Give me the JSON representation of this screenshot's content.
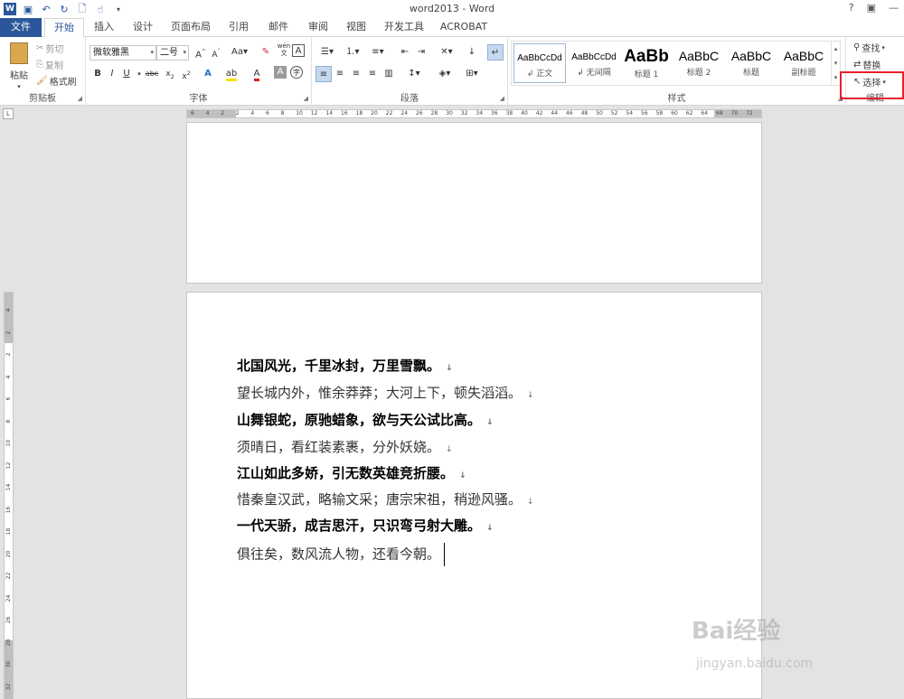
{
  "window": {
    "title": "word2013 - Word",
    "help": "?",
    "restore": "▣",
    "minimize": "—"
  },
  "tabs": {
    "file": "文件",
    "items": [
      "开始",
      "插入",
      "设计",
      "页面布局",
      "引用",
      "邮件",
      "审阅",
      "视图",
      "开发工具",
      "ACROBAT"
    ]
  },
  "clipboard": {
    "paste": "粘贴",
    "cut": "剪切",
    "copy": "复制",
    "format_painter": "格式刷",
    "label": "剪贴板"
  },
  "font": {
    "name": "微软雅黑",
    "size": "二号",
    "label": "字体",
    "aa": "Aa",
    "wen": "wén\n文"
  },
  "paragraph": {
    "label": "段落"
  },
  "styles": {
    "label": "样式",
    "items": [
      {
        "sample": "AaBbCcDd",
        "name": "↲ 正文"
      },
      {
        "sample": "AaBbCcDd",
        "name": "↲ 无间隔"
      },
      {
        "sample": "AaBb",
        "name": "标题 1"
      },
      {
        "sample": "AaBbC",
        "name": "标题 2"
      },
      {
        "sample": "AaBbC",
        "name": "标题"
      },
      {
        "sample": "AaBbC",
        "name": "副标题"
      }
    ]
  },
  "editing": {
    "find": "查找",
    "replace": "替换",
    "select": "选择",
    "label": "编辑"
  },
  "ruler": {
    "corner": "L",
    "h_ticks": [
      "6",
      "4",
      "2",
      "2",
      "4",
      "6",
      "8",
      "10",
      "12",
      "14",
      "16",
      "18",
      "20",
      "22",
      "24",
      "26",
      "28",
      "30",
      "32",
      "34",
      "36",
      "38",
      "40",
      "42",
      "44",
      "46",
      "48",
      "50",
      "52",
      "54",
      "56",
      "58",
      "60",
      "62",
      "64",
      "68",
      "70",
      "72"
    ],
    "v_ticks": [
      "4",
      "2",
      "2",
      "4",
      "6",
      "8",
      "10",
      "12",
      "14",
      "16",
      "18",
      "20",
      "22",
      "24",
      "26",
      "28",
      "30",
      "32"
    ]
  },
  "document": {
    "lines": [
      {
        "text": "北国风光，千里冰封，万里雪飘。",
        "bold": true
      },
      {
        "text": "望长城内外，惟余莽莽；大河上下，顿失滔滔。",
        "bold": false
      },
      {
        "text": "山舞银蛇，原驰蜡象，欲与天公试比高。",
        "bold": true
      },
      {
        "text": "须晴日，看红装素裹，分外妖娆。",
        "bold": false
      },
      {
        "text": "江山如此多娇，引无数英雄竞折腰。",
        "bold": true
      },
      {
        "text": "惜秦皇汉武，略输文采；唐宗宋祖，稍逊风骚。",
        "bold": false
      },
      {
        "text": "一代天骄，成吉思汗，只识弯弓射大雕。",
        "bold": true
      },
      {
        "text": "俱往矣，数风流人物，还看今朝。",
        "bold": false
      }
    ],
    "paragraph_mark": "↓"
  },
  "watermark": {
    "main": "Bai经验",
    "sub": "jingyan.baidu.com"
  }
}
